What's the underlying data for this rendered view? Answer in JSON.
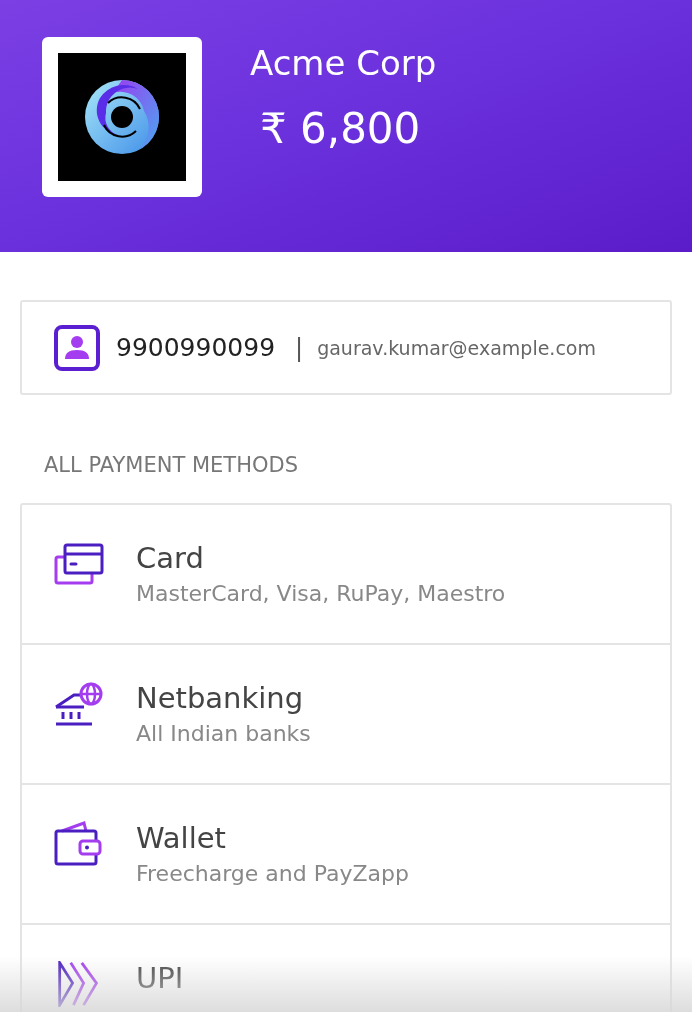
{
  "merchant": {
    "name": "Acme Corp",
    "amount": "₹ 6,800"
  },
  "contact": {
    "phone": "9900990099",
    "separator": "|",
    "email": "gaurav.kumar@example.com"
  },
  "section_title": "ALL PAYMENT METHODS",
  "methods": [
    {
      "kind": "card",
      "title": "Card",
      "subtitle": "MasterCard, Visa, RuPay, Maestro"
    },
    {
      "kind": "netbanking",
      "title": "Netbanking",
      "subtitle": "All Indian banks"
    },
    {
      "kind": "wallet",
      "title": "Wallet",
      "subtitle": "Freecharge and PayZapp"
    },
    {
      "kind": "upi",
      "title": "UPI"
    }
  ]
}
